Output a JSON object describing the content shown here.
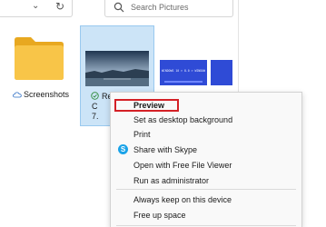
{
  "toolbar": {
    "search_placeholder": "Search Pictures"
  },
  "files": {
    "folder": {
      "name": "Screenshots"
    },
    "selected": {
      "caption_lines": [
        "Re",
        "C",
        "7."
      ]
    },
    "thumb2": {
      "text": "WINDOWS 10 > 8.0 > WINDOWS 11"
    }
  },
  "context_menu": {
    "items": [
      {
        "label": "Preview"
      },
      {
        "label": "Set as desktop background"
      },
      {
        "label": "Print"
      },
      {
        "label": "Share with Skype"
      },
      {
        "label": "Open with Free File Viewer"
      },
      {
        "label": "Run as administrator"
      },
      {
        "label": "Always keep on this device"
      },
      {
        "label": "Free up space"
      }
    ]
  },
  "colors": {
    "selection": "#cce4f7",
    "highlight_border": "#d42026",
    "folder": "#f8c548",
    "skype": "#1aa3e8"
  }
}
